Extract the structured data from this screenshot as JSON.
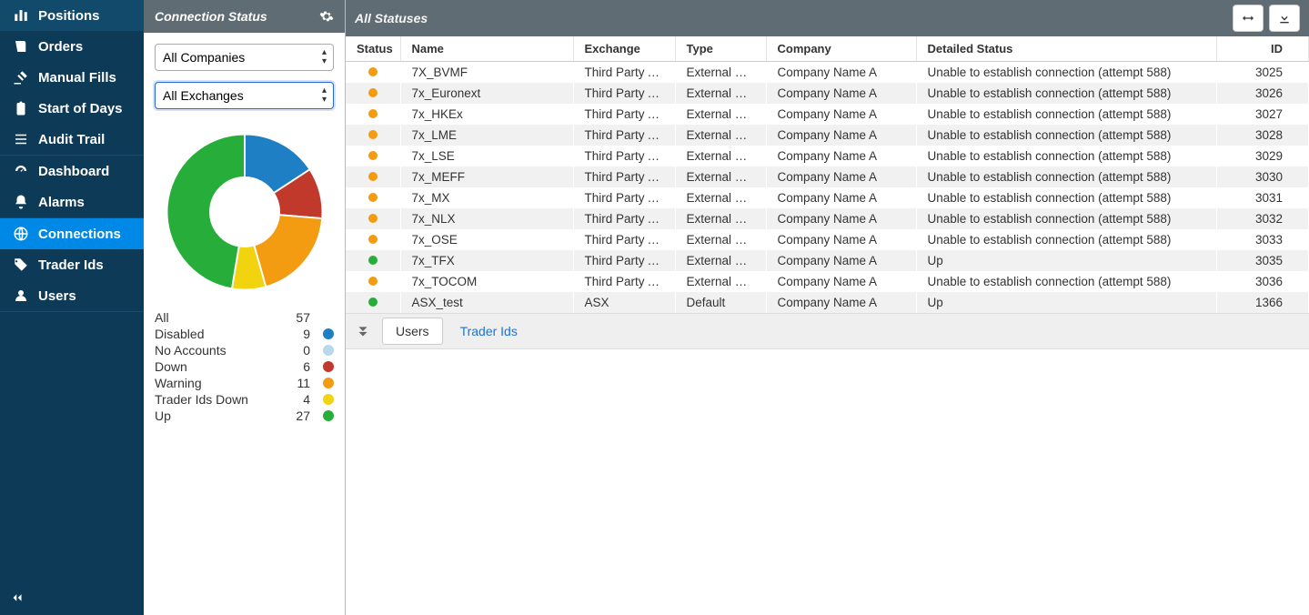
{
  "nav": {
    "groups": [
      {
        "items": [
          {
            "id": "positions",
            "label": "Positions",
            "icon": "bar"
          },
          {
            "id": "orders",
            "label": "Orders",
            "icon": "book"
          },
          {
            "id": "manualfills",
            "label": "Manual Fills",
            "icon": "gavel"
          },
          {
            "id": "sod",
            "label": "Start of Days",
            "icon": "clip"
          },
          {
            "id": "audit",
            "label": "Audit Trail",
            "icon": "list"
          }
        ]
      },
      {
        "items": [
          {
            "id": "dashboard",
            "label": "Dashboard",
            "icon": "dash"
          },
          {
            "id": "alarms",
            "label": "Alarms",
            "icon": "bell"
          }
        ]
      },
      {
        "items": [
          {
            "id": "connections",
            "label": "Connections",
            "icon": "globe",
            "active": true
          },
          {
            "id": "traderids",
            "label": "Trader Ids",
            "icon": "tag"
          },
          {
            "id": "users",
            "label": "Users",
            "icon": "user"
          }
        ]
      }
    ]
  },
  "panel": {
    "title": "Connection Status",
    "companies_select": "All Companies",
    "exchanges_select": "All Exchanges",
    "legend": [
      {
        "label": "All",
        "count": 57,
        "color": null
      },
      {
        "label": "Disabled",
        "count": 9,
        "color": "#1e7fc4"
      },
      {
        "label": "No Accounts",
        "count": 0,
        "color": "#b8d8ec"
      },
      {
        "label": "Down",
        "count": 6,
        "color": "#c0392b"
      },
      {
        "label": "Warning",
        "count": 11,
        "color": "#f39c12"
      },
      {
        "label": "Trader Ids Down",
        "count": 4,
        "color": "#f1d40f"
      },
      {
        "label": "Up",
        "count": 27,
        "color": "#27ae3a"
      }
    ]
  },
  "main": {
    "title": "All Statuses",
    "columns": [
      "Status",
      "Name",
      "Exchange",
      "Type",
      "Company",
      "Detailed Status",
      "ID"
    ],
    "rows": [
      {
        "status": "warning",
        "name": "7X_BVMF",
        "ex": "Third Party Algo",
        "type": "External Connecti...",
        "co": "Company Name A",
        "det": "Unable to establish connection (attempt 588)",
        "id": "3025"
      },
      {
        "status": "warning",
        "name": "7x_Euronext",
        "ex": "Third Party Algo",
        "type": "External Connecti...",
        "co": "Company Name A",
        "det": "Unable to establish connection (attempt 588)",
        "id": "3026"
      },
      {
        "status": "warning",
        "name": "7x_HKEx",
        "ex": "Third Party Algo",
        "type": "External Connecti...",
        "co": "Company Name A",
        "det": "Unable to establish connection (attempt 588)",
        "id": "3027"
      },
      {
        "status": "warning",
        "name": "7x_LME",
        "ex": "Third Party Algo",
        "type": "External Connecti...",
        "co": "Company Name A",
        "det": "Unable to establish connection (attempt 588)",
        "id": "3028"
      },
      {
        "status": "warning",
        "name": "7x_LSE",
        "ex": "Third Party Algo",
        "type": "External Connecti...",
        "co": "Company Name A",
        "det": "Unable to establish connection (attempt 588)",
        "id": "3029"
      },
      {
        "status": "warning",
        "name": "7x_MEFF",
        "ex": "Third Party Algo",
        "type": "External Connecti...",
        "co": "Company Name A",
        "det": "Unable to establish connection (attempt 588)",
        "id": "3030"
      },
      {
        "status": "warning",
        "name": "7x_MX",
        "ex": "Third Party Algo",
        "type": "External Connecti...",
        "co": "Company Name A",
        "det": "Unable to establish connection (attempt 588)",
        "id": "3031"
      },
      {
        "status": "warning",
        "name": "7x_NLX",
        "ex": "Third Party Algo",
        "type": "External Connecti...",
        "co": "Company Name A",
        "det": "Unable to establish connection (attempt 588)",
        "id": "3032"
      },
      {
        "status": "warning",
        "name": "7x_OSE",
        "ex": "Third Party Algo",
        "type": "External Connecti...",
        "co": "Company Name A",
        "det": "Unable to establish connection (attempt 588)",
        "id": "3033"
      },
      {
        "status": "up",
        "name": "7x_TFX",
        "ex": "Third Party Algo",
        "type": "External Connecti...",
        "co": "Company Name A",
        "det": "Up",
        "id": "3035"
      },
      {
        "status": "warning",
        "name": "7x_TOCOM",
        "ex": "Third Party Algo",
        "type": "External Connecti...",
        "co": "Company Name A",
        "det": "Unable to establish connection (attempt 588)",
        "id": "3036"
      },
      {
        "status": "up",
        "name": "ASX_test",
        "ex": "ASX",
        "type": "Default",
        "co": "Company Name A",
        "det": "Up",
        "id": "1366"
      }
    ],
    "subtabs": [
      {
        "label": "Users",
        "active": true
      },
      {
        "label": "Trader Ids",
        "active": false
      }
    ]
  },
  "chart_data": {
    "type": "pie",
    "title": "Connection Status",
    "series": [
      {
        "name": "Disabled",
        "value": 9,
        "color": "#1e7fc4"
      },
      {
        "name": "No Accounts",
        "value": 0,
        "color": "#b8d8ec"
      },
      {
        "name": "Down",
        "value": 6,
        "color": "#c0392b"
      },
      {
        "name": "Warning",
        "value": 11,
        "color": "#f39c12"
      },
      {
        "name": "Trader Ids Down",
        "value": 4,
        "color": "#f1d40f"
      },
      {
        "name": "Up",
        "value": 27,
        "color": "#27ae3a"
      }
    ],
    "total": 57
  },
  "status_colors": {
    "warning": "#f39c12",
    "up": "#27ae3a",
    "down": "#c0392b"
  }
}
